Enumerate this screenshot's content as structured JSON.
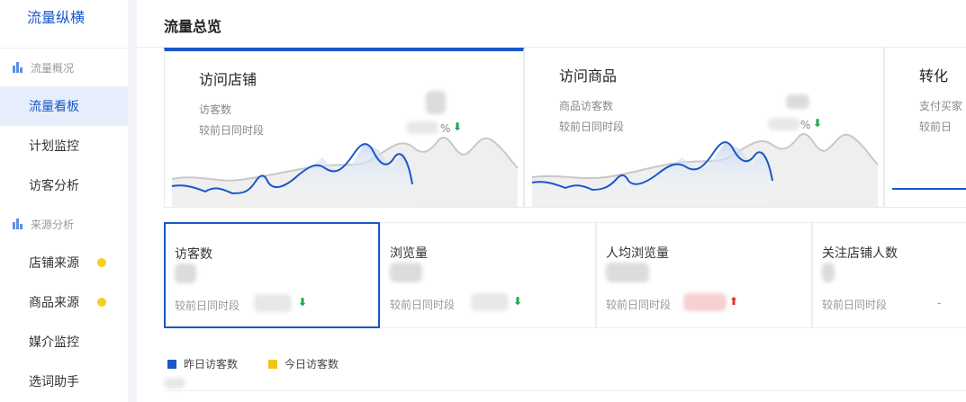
{
  "sidebar": {
    "brand": "流量纵横",
    "groups": [
      {
        "label": "流量概况",
        "icon": "bar-chart-icon"
      },
      {
        "label": "来源分析",
        "icon": "bar-chart-icon"
      }
    ],
    "items": [
      {
        "label": "流量看板",
        "active": true
      },
      {
        "label": "计划监控"
      },
      {
        "label": "访客分析"
      },
      {
        "label": "店铺来源",
        "dot": true
      },
      {
        "label": "商品来源",
        "dot": true
      },
      {
        "label": "媒介监控"
      },
      {
        "label": "选词助手"
      }
    ],
    "dot_color": "#f5d020"
  },
  "panel": {
    "title": "流量总览"
  },
  "cards": [
    {
      "title": "访问店铺",
      "row1": "访客数",
      "row2": "较前日同时段",
      "pct_suffix": "%",
      "trend": "down"
    },
    {
      "title": "访问商品",
      "row1": "商品访客数",
      "row2": "较前日同时段",
      "pct_suffix": "%",
      "trend": "down"
    },
    {
      "title": "转化",
      "row1": "支付买家",
      "row2": "较前日"
    }
  ],
  "tiles": [
    {
      "label": "访客数",
      "sub": "较前日同时段",
      "trend": "down",
      "selected": true
    },
    {
      "label": "浏览量",
      "sub": "较前日同时段",
      "trend": "down"
    },
    {
      "label": "人均浏览量",
      "sub": "较前日同时段",
      "trend": "up"
    },
    {
      "label": "关注店铺人数",
      "sub": "较前日同时段",
      "dash": "-"
    }
  ],
  "legend": [
    {
      "label": "昨日访客数",
      "color": "#1a57c8"
    },
    {
      "label": "今日访客数",
      "color": "#f0c419"
    }
  ],
  "colors": {
    "accent": "#1a57c8",
    "down": "#1aa84c",
    "up": "#e8312f"
  }
}
